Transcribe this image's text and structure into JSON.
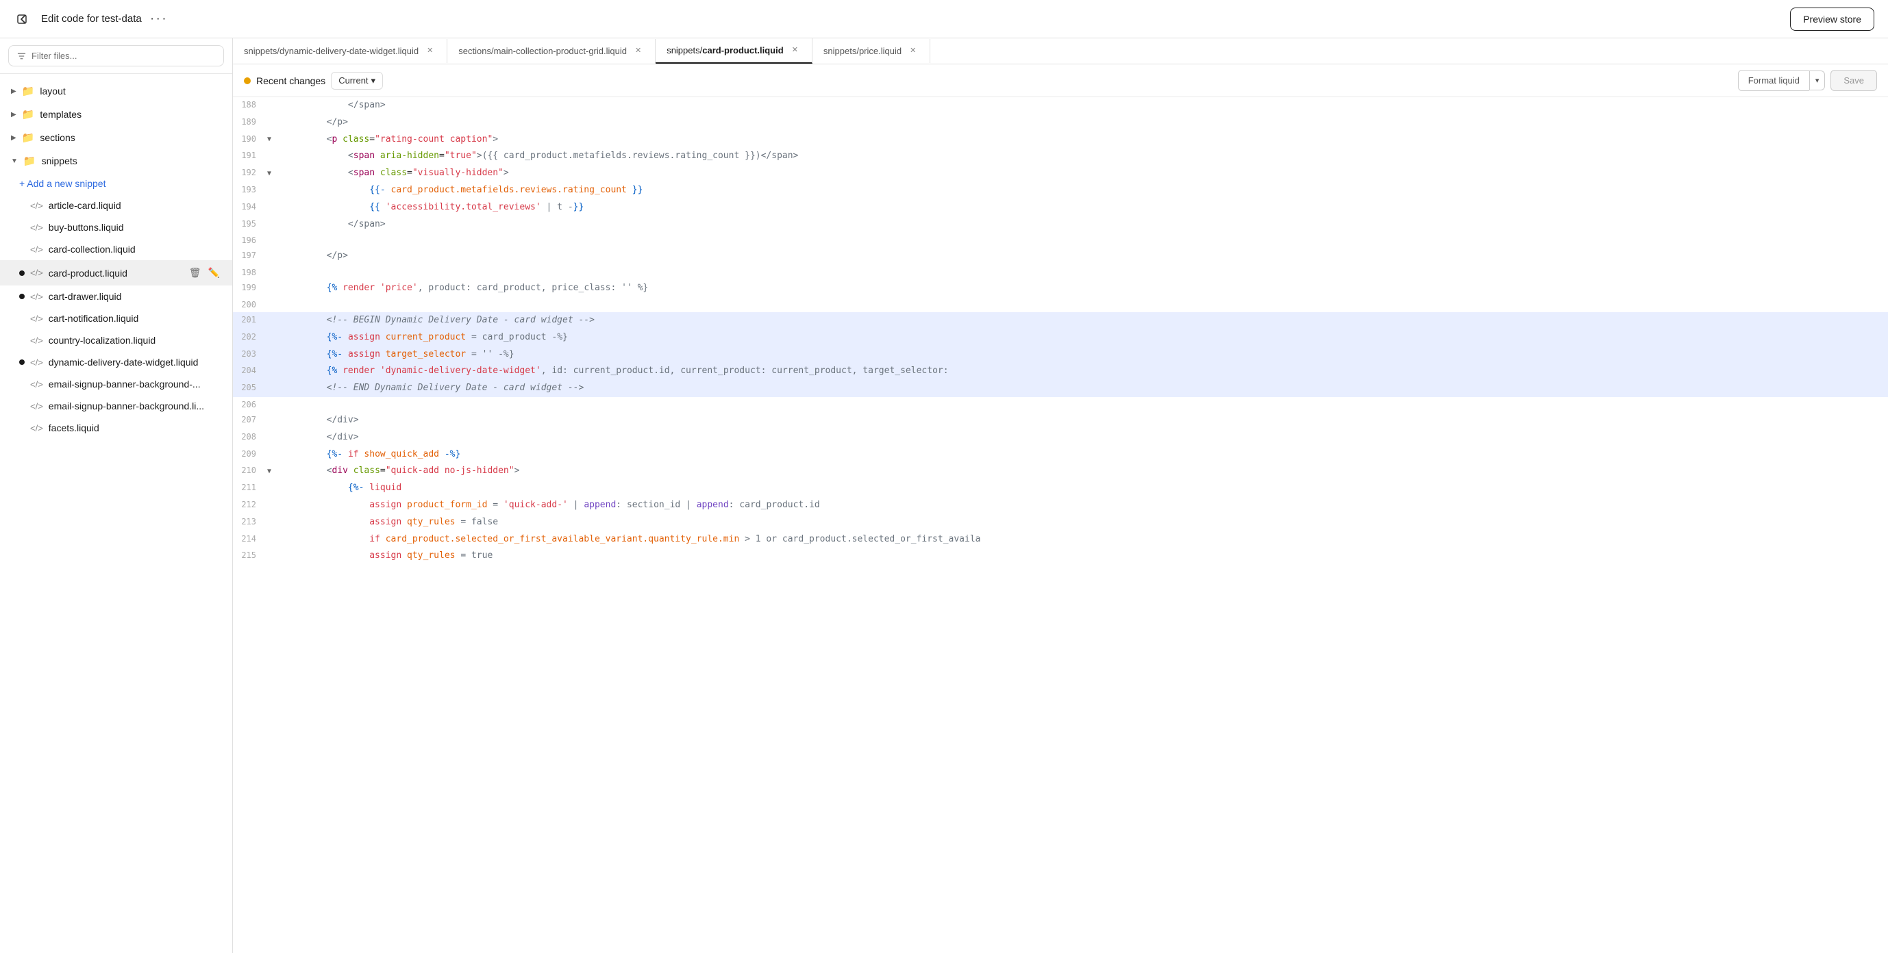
{
  "topbar": {
    "title": "Edit code for test-data",
    "preview_label": "Preview store"
  },
  "sidebar": {
    "filter_placeholder": "Filter files...",
    "items": [
      {
        "id": "layout",
        "label": "layout",
        "type": "folder",
        "expanded": false
      },
      {
        "id": "templates",
        "label": "templates",
        "type": "folder",
        "expanded": false
      },
      {
        "id": "sections",
        "label": "sections",
        "type": "folder",
        "expanded": false
      },
      {
        "id": "snippets",
        "label": "snippets",
        "type": "folder",
        "expanded": true
      }
    ],
    "add_snippet_label": "+ Add a new snippet",
    "snippets": [
      {
        "id": "article-card",
        "label": "article-card.liquid",
        "active": false,
        "dot": false
      },
      {
        "id": "buy-buttons",
        "label": "buy-buttons.liquid",
        "active": false,
        "dot": false
      },
      {
        "id": "card-collection",
        "label": "card-collection.liquid",
        "active": false,
        "dot": false
      },
      {
        "id": "card-product",
        "label": "card-product.liquid",
        "active": true,
        "dot": true
      },
      {
        "id": "cart-drawer",
        "label": "cart-drawer.liquid",
        "active": false,
        "dot": true
      },
      {
        "id": "cart-notification",
        "label": "cart-notification.liquid",
        "active": false,
        "dot": false
      },
      {
        "id": "country-localization",
        "label": "country-localization.liquid",
        "active": false,
        "dot": false
      },
      {
        "id": "dynamic-delivery-date-widget",
        "label": "dynamic-delivery-date-widget.liquid",
        "active": false,
        "dot": true
      },
      {
        "id": "email-signup-banner-background",
        "label": "email-signup-banner-background-...",
        "active": false,
        "dot": false
      },
      {
        "id": "email-signup-banner-background-li",
        "label": "email-signup-banner-background.li...",
        "active": false,
        "dot": false
      },
      {
        "id": "facets",
        "label": "facets.liquid",
        "active": false,
        "dot": false
      }
    ]
  },
  "tabs": [
    {
      "id": "dynamic-delivery",
      "path": "snippets/dynamic-delivery-date-widget.liquid",
      "active": false
    },
    {
      "id": "main-collection",
      "path": "sections/main-collection-product-grid.liquid",
      "active": false
    },
    {
      "id": "card-product",
      "path": "snippets/card-product.liquid",
      "active": true
    },
    {
      "id": "price",
      "path": "snippets/price.liquid",
      "active": false
    }
  ],
  "editor": {
    "recent_changes_label": "Recent changes",
    "current_label": "Current",
    "format_liquid_label": "Format liquid",
    "save_label": "Save"
  },
  "code_lines": [
    {
      "num": 188,
      "arrow": false,
      "highlighted": false,
      "html": "<span class='gray'>            &lt;/span&gt;</span>"
    },
    {
      "num": 189,
      "arrow": false,
      "highlighted": false,
      "html": "<span class='gray'>        &lt;/p&gt;</span>"
    },
    {
      "num": 190,
      "arrow": true,
      "highlighted": false,
      "html": "<span class='gray'>        &lt;</span><span class='tag'>p</span> <span class='attr-name'>class</span>=<span class='string'>\"rating-count caption\"</span><span class='gray'>&gt;</span>"
    },
    {
      "num": 191,
      "arrow": false,
      "highlighted": false,
      "html": "<span class='gray'>            &lt;</span><span class='tag'>span</span> <span class='attr-name'>aria-hidden</span>=<span class='string'>\"true\"</span><span class='gray'>&gt;({{ card_product.metafields.reviews.rating_count }})&lt;/span&gt;</span>"
    },
    {
      "num": 192,
      "arrow": true,
      "highlighted": false,
      "html": "<span class='gray'>            &lt;</span><span class='tag'>span</span> <span class='attr-name'>class</span>=<span class='string'>\"visually-hidden\"</span><span class='gray'>&gt;</span>"
    },
    {
      "num": 193,
      "arrow": false,
      "highlighted": false,
      "html": "<span class='gray'>                </span><span class='blue'>{{-</span> <span class='orange'>card_product.metafields.reviews.rating_count</span> <span class='blue'>}}</span>"
    },
    {
      "num": 194,
      "arrow": false,
      "highlighted": false,
      "html": "<span class='gray'>                </span><span class='blue'>{{</span> <span class='string'>'accessibility.total_reviews'</span> <span class='gray'>| t -</span><span class='blue'>}}</span>"
    },
    {
      "num": 195,
      "arrow": false,
      "highlighted": false,
      "html": "<span class='gray'>            &lt;/span&gt;</span>"
    },
    {
      "num": 196,
      "arrow": false,
      "highlighted": false,
      "html": ""
    },
    {
      "num": 197,
      "arrow": false,
      "highlighted": false,
      "html": "<span class='gray'>        &lt;/p&gt;</span>"
    },
    {
      "num": 198,
      "arrow": false,
      "highlighted": false,
      "html": ""
    },
    {
      "num": 199,
      "arrow": false,
      "highlighted": false,
      "html": "<span class='gray'>        </span><span class='blue'>{%</span> <span class='keyword'>render</span> <span class='string'>'price'</span><span class='gray'>, product: card_product, price_class: '' %}</span>"
    },
    {
      "num": 200,
      "arrow": false,
      "highlighted": false,
      "html": ""
    },
    {
      "num": 201,
      "arrow": false,
      "highlighted": true,
      "html": "<span class='gray'>        </span><span class='comment'>&lt;!-- BEGIN Dynamic Delivery Date - card widget --&gt;</span>"
    },
    {
      "num": 202,
      "arrow": false,
      "highlighted": true,
      "html": "<span class='gray'>        </span><span class='blue'>{%-</span> <span class='keyword'>assign</span> <span class='orange'>current_product</span> <span class='gray'>= card_product -%}</span>"
    },
    {
      "num": 203,
      "arrow": false,
      "highlighted": true,
      "html": "<span class='gray'>        </span><span class='blue'>{%-</span> <span class='keyword'>assign</span> <span class='orange'>target_selector</span> <span class='gray'>= '' -%}</span>"
    },
    {
      "num": 204,
      "arrow": false,
      "highlighted": true,
      "html": "<span class='gray'>        </span><span class='blue'>{%</span> <span class='keyword'>render</span> <span class='string'>'dynamic-delivery-date-widget'</span><span class='gray'>, id: current_product.id, current_product: current_product, target_selector:</span>"
    },
    {
      "num": 205,
      "arrow": false,
      "highlighted": true,
      "html": "<span class='gray'>        </span><span class='comment'>&lt;!-- END Dynamic Delivery Date - card widget --&gt;</span>"
    },
    {
      "num": 206,
      "arrow": false,
      "highlighted": false,
      "html": ""
    },
    {
      "num": 207,
      "arrow": false,
      "highlighted": false,
      "html": "<span class='gray'>        &lt;/div&gt;</span>"
    },
    {
      "num": 208,
      "arrow": false,
      "highlighted": false,
      "html": "<span class='gray'>        &lt;/div&gt;</span>"
    },
    {
      "num": 209,
      "arrow": false,
      "highlighted": false,
      "html": "<span class='gray'>        </span><span class='blue'>{%-</span> <span class='keyword'>if</span> <span class='orange'>show_quick_add</span> <span class='blue'>-%}</span>"
    },
    {
      "num": 210,
      "arrow": true,
      "highlighted": false,
      "html": "<span class='gray'>        &lt;</span><span class='tag'>div</span> <span class='attr-name'>class</span>=<span class='string'>\"quick-add no-js-hidden\"</span><span class='gray'>&gt;</span>"
    },
    {
      "num": 211,
      "arrow": false,
      "highlighted": false,
      "html": "<span class='gray'>            </span><span class='blue'>{%-</span> <span class='keyword'>liquid</span>"
    },
    {
      "num": 212,
      "arrow": false,
      "highlighted": false,
      "html": "<span class='gray'>                </span><span class='keyword'>assign</span> <span class='orange'>product_form_id</span> <span class='gray'>= </span><span class='string'>'quick-add-'</span> <span class='gray'>| </span><span class='function'>append</span><span class='gray'>: section_id | </span><span class='function'>append</span><span class='gray'>: card_product.id</span>"
    },
    {
      "num": 213,
      "arrow": false,
      "highlighted": false,
      "html": "<span class='gray'>                </span><span class='keyword'>assign</span> <span class='orange'>qty_rules</span> <span class='gray'>= false</span>"
    },
    {
      "num": 214,
      "arrow": false,
      "highlighted": false,
      "html": "<span class='gray'>                </span><span class='keyword'>if</span> <span class='orange'>card_product.selected_or_first_available_variant.quantity_rule.min</span> <span class='gray'>&gt; 1 or card_product.selected_or_first_availa</span>"
    },
    {
      "num": 215,
      "arrow": false,
      "highlighted": false,
      "html": "<span class='gray'>                </span><span class='keyword'>assign</span> <span class='orange'>qty_rules</span> <span class='gray'>= true</span>"
    }
  ]
}
